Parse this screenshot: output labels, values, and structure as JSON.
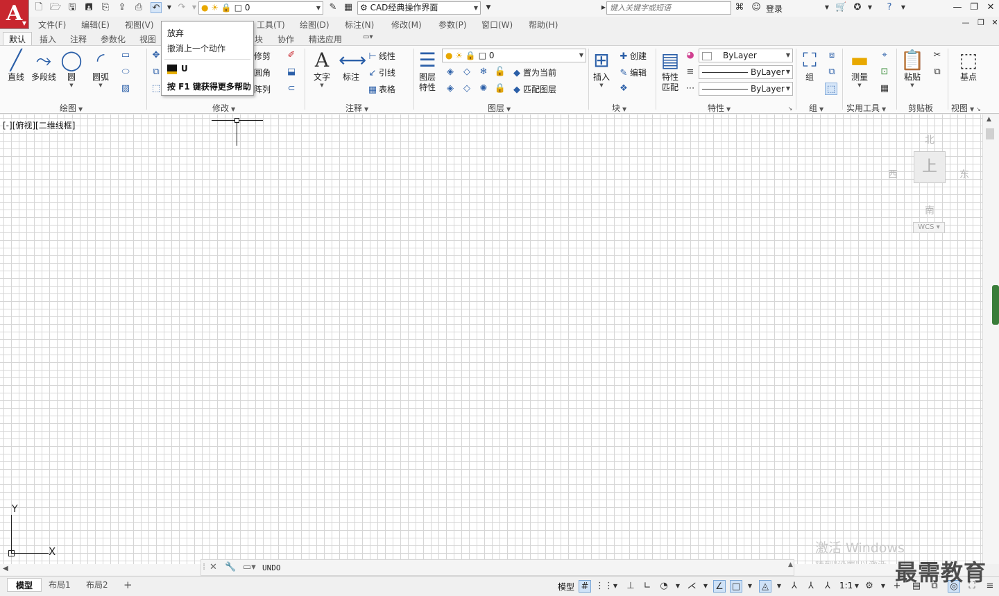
{
  "quick_access": {
    "layer_value": "0",
    "workspace": "CAD经典操作界面",
    "search_placeholder": "键入关键字或短语",
    "login_label": "登录"
  },
  "menu": [
    "文件(F)",
    "编辑(E)",
    "视图(V)",
    "工具(T)",
    "绘图(D)",
    "标注(N)",
    "修改(M)",
    "参数(P)",
    "窗口(W)",
    "帮助(H)"
  ],
  "ribbon_tabs": [
    "默认",
    "插入",
    "注释",
    "参数化",
    "视图",
    "块",
    "协作",
    "精选应用"
  ],
  "ribbon": {
    "draw": {
      "title": "绘图",
      "line": "直线",
      "polyline": "多段线",
      "circle": "圆",
      "arc": "圆弧"
    },
    "modify": {
      "title": "修改",
      "trim": "修剪",
      "fillet": "圆角",
      "array": "阵列"
    },
    "annotation": {
      "title": "注释",
      "text": "文字",
      "dimension": "标注",
      "linear": "线性",
      "leader": "引线",
      "table": "表格"
    },
    "layers": {
      "title": "图层",
      "layer_props_1": "图层",
      "layer_props_2": "特性",
      "layer_value": "0",
      "set_current": "置为当前",
      "match_layer": "匹配图层"
    },
    "block": {
      "title": "块",
      "insert": "插入",
      "create": "创建",
      "edit": "编辑"
    },
    "properties": {
      "title": "特性",
      "match_1": "特性",
      "match_2": "匹配",
      "color": "ByLayer",
      "lineweight": "ByLayer",
      "linetype": "ByLayer"
    },
    "groups": {
      "title": "组",
      "group": "组"
    },
    "utilities": {
      "title": "实用工具",
      "measure": "测量"
    },
    "clipboard": {
      "title": "剪贴板",
      "paste": "粘贴"
    },
    "view": {
      "title": "视图",
      "basepoint": "基点"
    }
  },
  "tooltip": {
    "title": "放弃",
    "description": "撤消上一个动作",
    "command": "U",
    "help": "按 F1 键获得更多帮助"
  },
  "viewport": {
    "label": "[-][俯视][二维线框]"
  },
  "viewcube": {
    "north": "北",
    "south": "南",
    "east": "东",
    "west": "西",
    "top": "上",
    "wcs": "WCS"
  },
  "ucs": {
    "x": "X",
    "y": "Y"
  },
  "watermark": {
    "line1": "激活 Windows",
    "line2": "转到\"设置\"以激活"
  },
  "command_line": {
    "prompt": "UNDO"
  },
  "layouts": [
    "模型",
    "布局1",
    "布局2"
  ],
  "status": {
    "model": "模型",
    "scale": "1:1"
  },
  "brand_watermark": "最需教育"
}
